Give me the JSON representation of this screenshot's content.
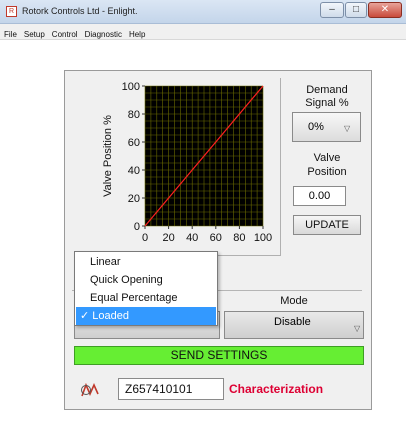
{
  "window": {
    "title": "Rotork Controls Ltd - Enlight.",
    "app_icon": "R",
    "minimize": "–",
    "maximize": "□",
    "close": "✕"
  },
  "menu": [
    "File",
    "Setup",
    "Control",
    "Diagnostic",
    "Help"
  ],
  "demand": {
    "label_line1": "Demand",
    "label_line2": "Signal %",
    "value": "0%",
    "caret": "▽"
  },
  "valve": {
    "label_line1": "Valve",
    "label_line2": "Position",
    "value": "0.00"
  },
  "update_label": "UPDATE",
  "mode": {
    "label": "Mode",
    "value": "Disable",
    "caret": "▽"
  },
  "shape_dropdown": {
    "options": [
      "Linear",
      "Quick Opening",
      "Equal Percentage",
      "✓ Loaded"
    ],
    "selected_index": 3
  },
  "send_label": "SEND SETTINGS",
  "serial": "Z657410101",
  "char_label": "Characterization",
  "colors": {
    "accent_red": "#dd0033",
    "send_green": "#66ee33",
    "grid_yellow": "#6b6b00",
    "plot_bg": "#000000",
    "line_red": "#ff2020",
    "highlight_blue": "#3399ff"
  },
  "chart_data": {
    "type": "line",
    "ylabel": "Valve Position %",
    "xlabel": "",
    "x_ticks": [
      "0",
      "20",
      "40",
      "60",
      "80",
      "100"
    ],
    "y_ticks": [
      "0",
      "20",
      "40",
      "60",
      "80",
      "100"
    ],
    "xlim": [
      0,
      100
    ],
    "ylim": [
      0,
      100
    ],
    "grid": true,
    "series": [
      {
        "x": [
          0,
          100
        ],
        "y": [
          0,
          100
        ]
      }
    ]
  }
}
